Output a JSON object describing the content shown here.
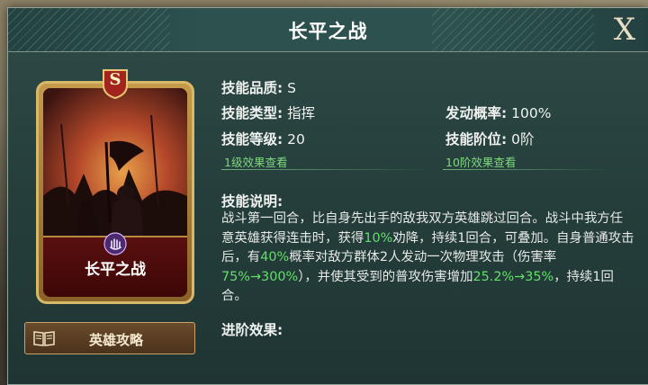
{
  "dialog": {
    "title": "长平之战",
    "close_label": "X"
  },
  "card": {
    "rarity": "S",
    "name": "长平之战",
    "emblem_icon": "purple-hand-emblem-icon"
  },
  "guide_button": {
    "icon": "book-icon",
    "label": "英雄攻略"
  },
  "skill": {
    "quality_label": "技能品质:",
    "quality_value": "S",
    "type_label": "技能类型:",
    "type_value": "指挥",
    "rate_label": "发动概率:",
    "rate_value": "100%",
    "level_label": "技能等级:",
    "level_value": "20",
    "rank_label": "技能阶位:",
    "rank_value": "0阶",
    "level_link": "1级效果查看",
    "rank_link": "10阶效果查看",
    "description_label": "技能说明:",
    "description": [
      {
        "text": "战斗第一回合，比自身先出手的敌我双方英雄跳过回合。战斗中我方任意英雄获得连击时，获得",
        "hl": false
      },
      {
        "text": "10%",
        "hl": true
      },
      {
        "text": "劝降，持续1回合，可叠加。自身普通攻击后，有",
        "hl": false
      },
      {
        "text": "40%",
        "hl": true
      },
      {
        "text": "概率对敌方群体2人发动一次物理攻击（伤害率",
        "hl": false
      },
      {
        "text": "75%→300%",
        "hl": true
      },
      {
        "text": "），并使其受到的普攻伤害增加",
        "hl": false
      },
      {
        "text": "25.2%→35%",
        "hl": true
      },
      {
        "text": "，持续1回合。",
        "hl": false
      }
    ],
    "advance_label": "进阶效果:"
  },
  "colors": {
    "panel": "#2b4745",
    "highlight": "#63e06a",
    "link": "#7ed87e",
    "card_gold": "#d7b96a",
    "card_red": "#5a1010"
  }
}
